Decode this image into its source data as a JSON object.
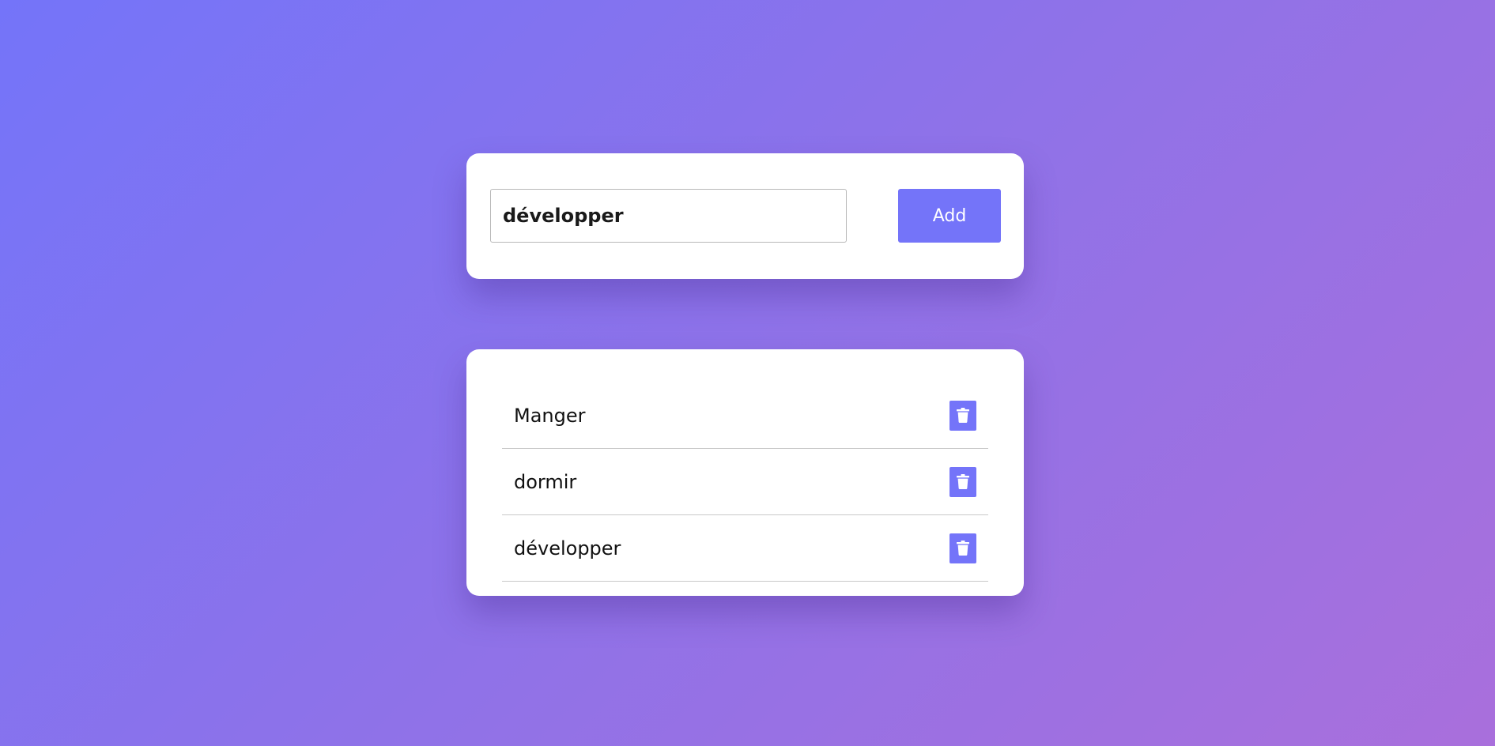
{
  "form": {
    "input_value": "développer",
    "add_label": "Add"
  },
  "tasks": [
    {
      "label": "Manger",
      "icon": "trash-icon"
    },
    {
      "label": "dormir",
      "icon": "trash-icon"
    },
    {
      "label": "développer",
      "icon": "trash-icon"
    }
  ],
  "colors": {
    "accent": "#7474f9",
    "background_start": "#7474f9",
    "background_end": "#a96fdc"
  }
}
